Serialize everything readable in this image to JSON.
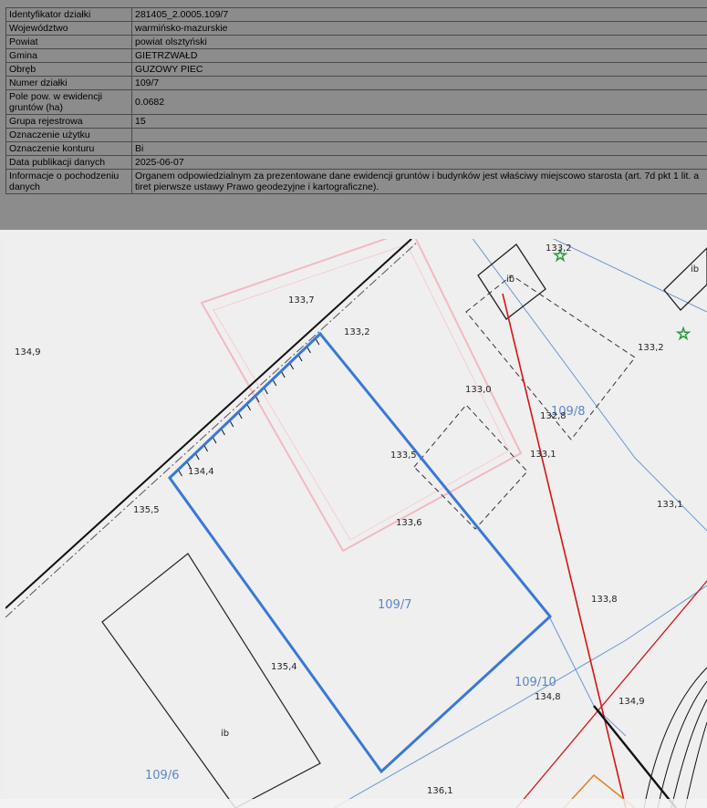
{
  "info": {
    "rows": [
      {
        "label": "Identyfikator działki",
        "value": "281405_2.0005.109/7"
      },
      {
        "label": "Województwo",
        "value": "warmińsko-mazurskie"
      },
      {
        "label": "Powiat",
        "value": "powiat olsztyński"
      },
      {
        "label": "Gmina",
        "value": "GIETRZWAŁD"
      },
      {
        "label": "Obręb",
        "value": "GUZOWY PIEC"
      },
      {
        "label": "Numer działki",
        "value": "109/7"
      },
      {
        "label": "Pole pow. w ewidencji gruntów (ha)",
        "value": "0.0682"
      },
      {
        "label": "Grupa rejestrowa",
        "value": "15"
      },
      {
        "label": "Oznaczenie użytku",
        "value": ""
      },
      {
        "label": "Oznaczenie konturu",
        "value": "Bi"
      },
      {
        "label": "Data publikacji danych",
        "value": "2025-06-07"
      },
      {
        "label": "Informacje o pochodzeniu danych",
        "value": "Organem odpowiedzialnym za prezentowane dane ewidencji gruntów i budynków jest właściwy miejscowo starosta (art. 7d pkt 1 lit. a tiret pierwsze ustawy Prawo geodezyjne i kartograficzne)."
      }
    ]
  },
  "map": {
    "parcel_labels": {
      "p1097": "109/7",
      "p1098": "109/8",
      "p1096": "109/6",
      "p10910": "109/10"
    },
    "heights": {
      "h1339": "134,9",
      "h1337": "133,7",
      "h1332a": "133,2",
      "h1332b": "133,2",
      "h1332c": "133,2",
      "h1330": "133,0",
      "h1328": "132,8",
      "h1335": "133,5",
      "h1331a": "133,1",
      "h1331b": "133,1",
      "h1344": "134,4",
      "h1355": "135,5",
      "h1336": "133,6",
      "h1338": "133,8",
      "h1354": "135,4",
      "h1348": "134,8",
      "h1349": "134,9",
      "h1361": "136,1"
    },
    "building_labels": {
      "b1": "ib",
      "b2": "ib",
      "b3": "ib"
    },
    "colors": {
      "parcel_outline": "#3a78d4",
      "red_line": "#d21414",
      "pink_building": "#f3b9c2",
      "thin_blue": "#6a97d6",
      "star_green": "#2e9a3e",
      "orange": "#e08020"
    }
  }
}
